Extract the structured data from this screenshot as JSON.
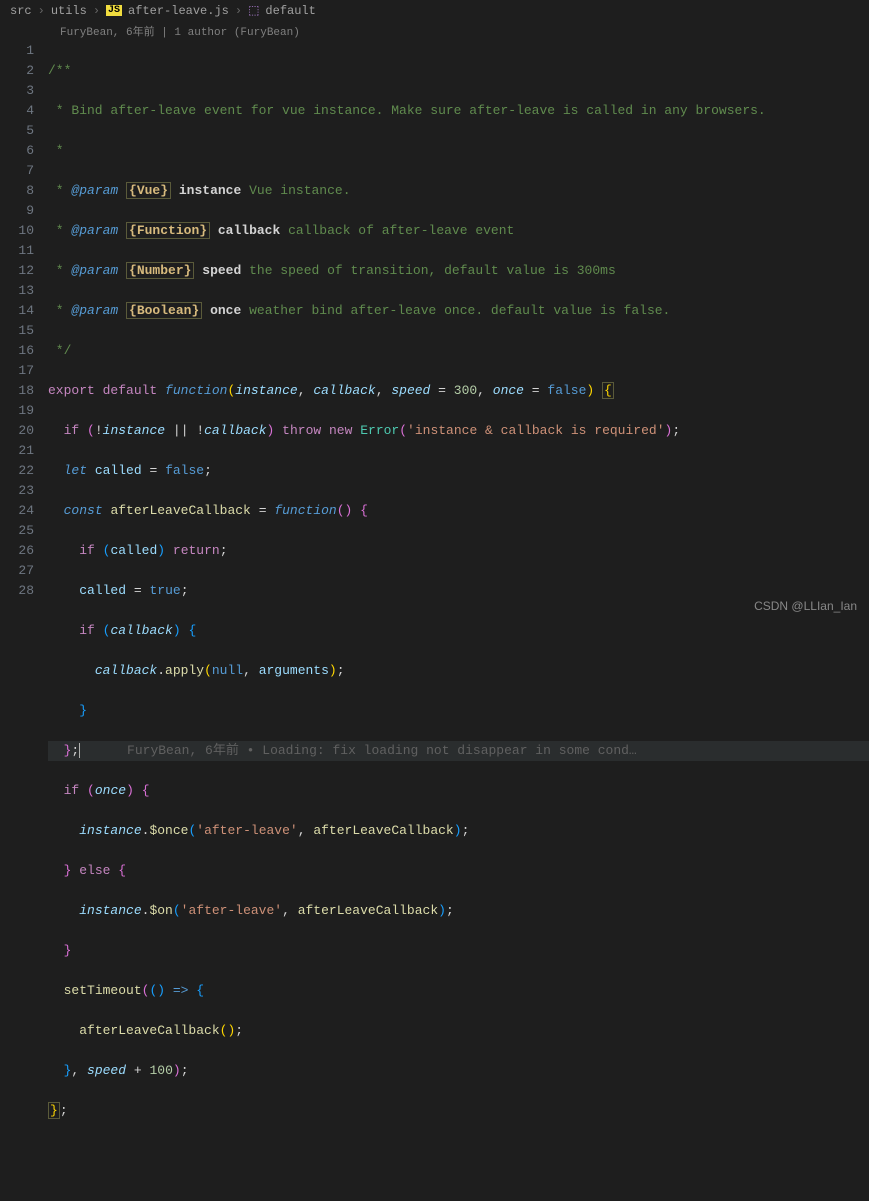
{
  "breadcrumb": {
    "seg0": "src",
    "seg1": "utils",
    "seg2": "after-leave.js",
    "seg3": "default"
  },
  "authorship": "FuryBean, 6年前 | 1 author (FuryBean)",
  "lines": {
    "l1": "/**",
    "l2_a": " * Bind after-leave event for vue instance. Make sure after-leave is called in any browsers.",
    "l3": " *",
    "l4_star": " * ",
    "l4_tag": "@param",
    "l4_type": "{Vue}",
    "l4_name": "instance",
    "l4_desc": "Vue instance.",
    "l5_tag": "@param",
    "l5_type": "{Function}",
    "l5_name": "callback",
    "l5_desc": "callback of after-leave event",
    "l6_tag": "@param",
    "l6_type": "{Number}",
    "l6_name": "speed",
    "l6_desc": "the speed of transition, default value is 300ms",
    "l7_tag": "@param",
    "l7_type": "{Boolean}",
    "l7_name": "once",
    "l7_desc": "weather bind after-leave once. default value is false.",
    "l8": " */",
    "l9_export": "export",
    "l9_default": "default",
    "l9_function": "function",
    "l9_p1": "instance",
    "l9_p2": "callback",
    "l9_p3": "speed",
    "l9_v3": "300",
    "l9_p4": "once",
    "l9_v4": "false",
    "l10_if": "if",
    "l10_p1": "instance",
    "l10_p2": "callback",
    "l10_throw": "throw",
    "l10_new": "new",
    "l10_err": "Error",
    "l10_str": "'instance & callback is required'",
    "l11_let": "let",
    "l11_var": "called",
    "l11_val": "false",
    "l12_const": "const",
    "l12_var": "afterLeaveCallback",
    "l12_fn": "function",
    "l13_if": "if",
    "l13_var": "called",
    "l13_ret": "return",
    "l14_var": "called",
    "l14_val": "true",
    "l15_if": "if",
    "l15_var": "callback",
    "l16_var": "callback",
    "l16_apply": "apply",
    "l16_null": "null",
    "l16_args": "arguments",
    "l18_lens": "FuryBean, 6年前 • Loading: fix loading not disappear in some cond…",
    "l19_if": "if",
    "l19_var": "once",
    "l20_inst": "instance",
    "l20_method": "$once",
    "l20_str": "'after-leave'",
    "l20_cb": "afterLeaveCallback",
    "l21_else": "else",
    "l22_inst": "instance",
    "l22_method": "$on",
    "l22_str": "'after-leave'",
    "l22_cb": "afterLeaveCallback",
    "l24_fn": "setTimeout",
    "l25_cb": "afterLeaveCallback",
    "l26_var": "speed",
    "l26_num": "100"
  },
  "watermark": "CSDN @LLIan_Ian"
}
